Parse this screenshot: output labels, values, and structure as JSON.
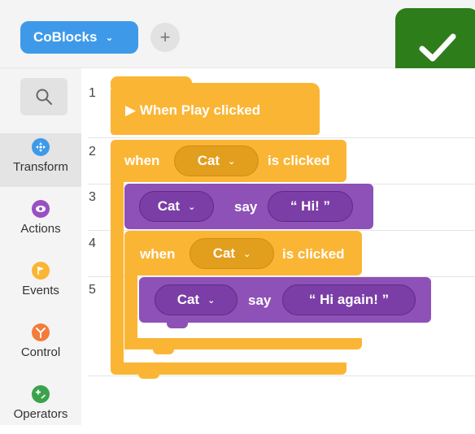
{
  "project": {
    "name": "CoBlocks",
    "add_label": "+"
  },
  "sidebar": {
    "items": [
      {
        "label": "Transform",
        "color": "#3e9ae9",
        "icon": "move-arrows-icon"
      },
      {
        "label": "Actions",
        "color": "#9b4fc4",
        "icon": "eye-icon"
      },
      {
        "label": "Events",
        "color": "#fbb534",
        "icon": "flag-icon"
      },
      {
        "label": "Control",
        "color": "#f47b3a",
        "icon": "branch-icon"
      },
      {
        "label": "Operators",
        "color": "#3aa34b",
        "icon": "plus-minus-icon"
      }
    ]
  },
  "workspace": {
    "line_numbers": [
      "1",
      "2",
      "3",
      "4",
      "5"
    ],
    "blocks": {
      "play": {
        "label": "▶ When Play clicked"
      },
      "when1": {
        "prefix": "when",
        "target": "Cat",
        "suffix": "is clicked"
      },
      "say1": {
        "actor": "Cat",
        "verb": "say",
        "text": "“ Hi! ”"
      },
      "when2": {
        "prefix": "when",
        "target": "Cat",
        "suffix": "is clicked"
      },
      "say2": {
        "actor": "Cat",
        "verb": "say",
        "text": "“ Hi again! ”"
      }
    }
  },
  "colors": {
    "events": "#fbb534",
    "actions": "#8d51b7",
    "accent": "#3e9ae9",
    "run": "#2e7d1b"
  }
}
